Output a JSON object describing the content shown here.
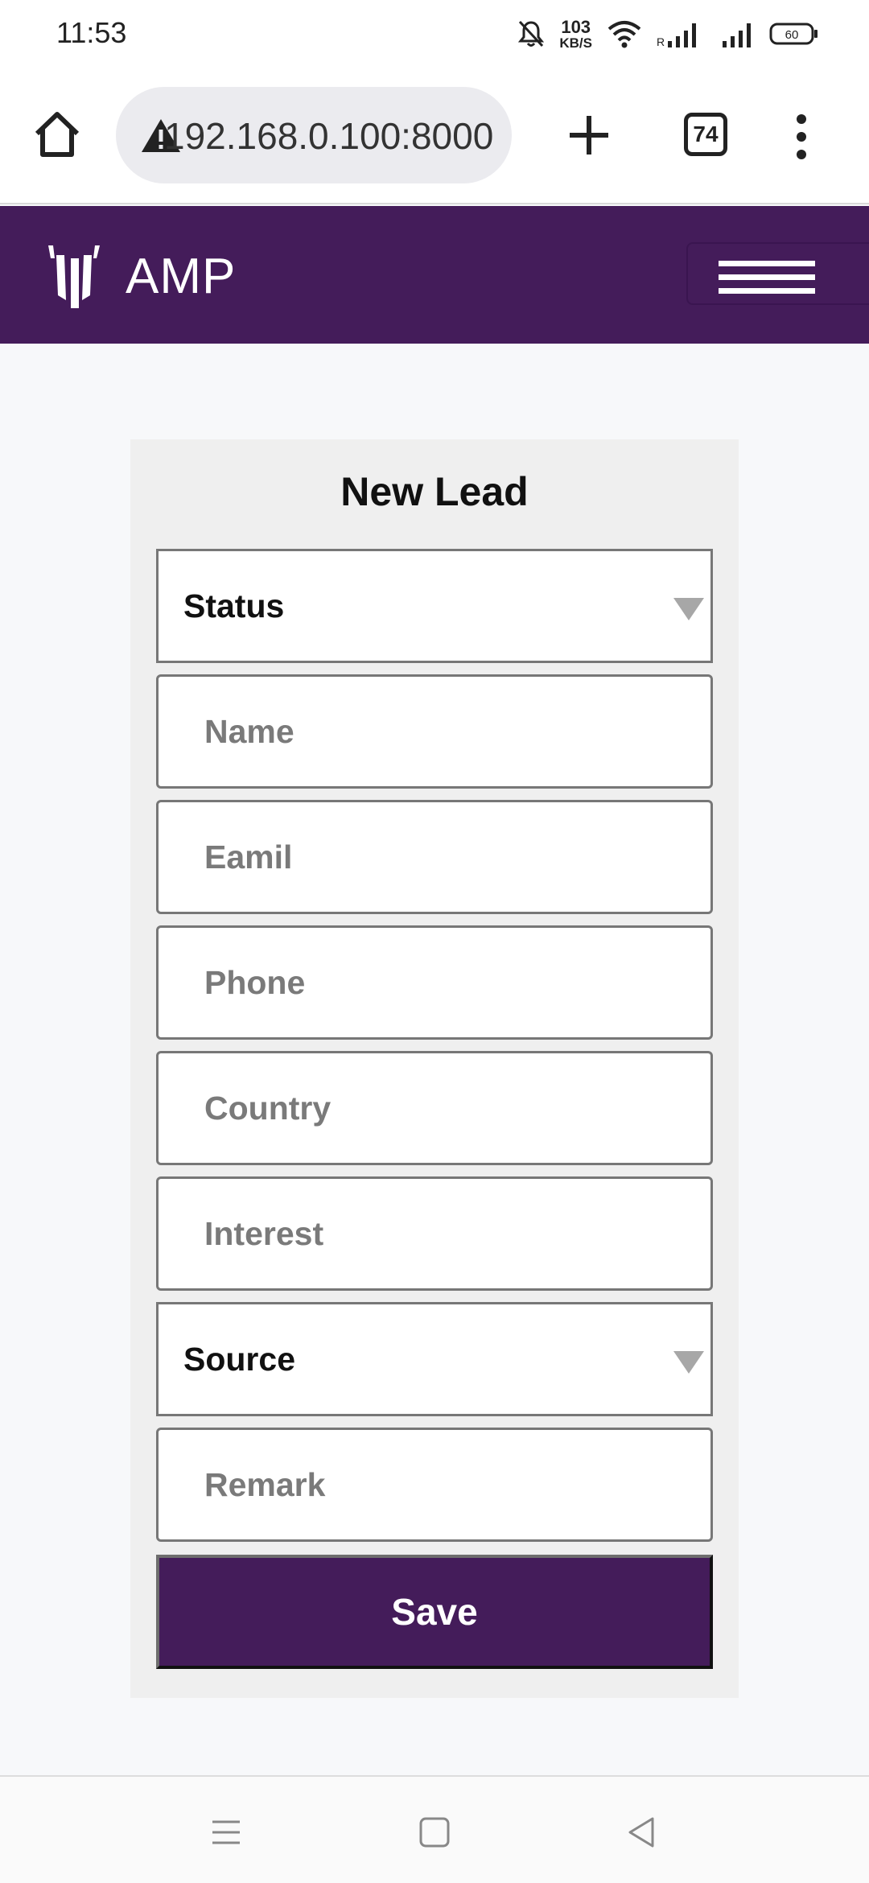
{
  "status_bar": {
    "time": "11:53",
    "speed_value": "103",
    "speed_unit": "KB/S",
    "battery": "60",
    "roaming": "R"
  },
  "browser": {
    "url": "192.168.0.100:8000",
    "tab_count": "74"
  },
  "header": {
    "logo_text": "AMP"
  },
  "form": {
    "title": "New Lead",
    "status_label": "Status",
    "name_placeholder": "Name",
    "email_placeholder": "Eamil",
    "phone_placeholder": "Phone",
    "country_placeholder": "Country",
    "interest_placeholder": "Interest",
    "source_label": "Source",
    "remark_placeholder": "Remark",
    "save_label": "Save"
  },
  "colors": {
    "brand": "#441c5a",
    "background": "#f7f8fa",
    "card": "#efefef"
  }
}
